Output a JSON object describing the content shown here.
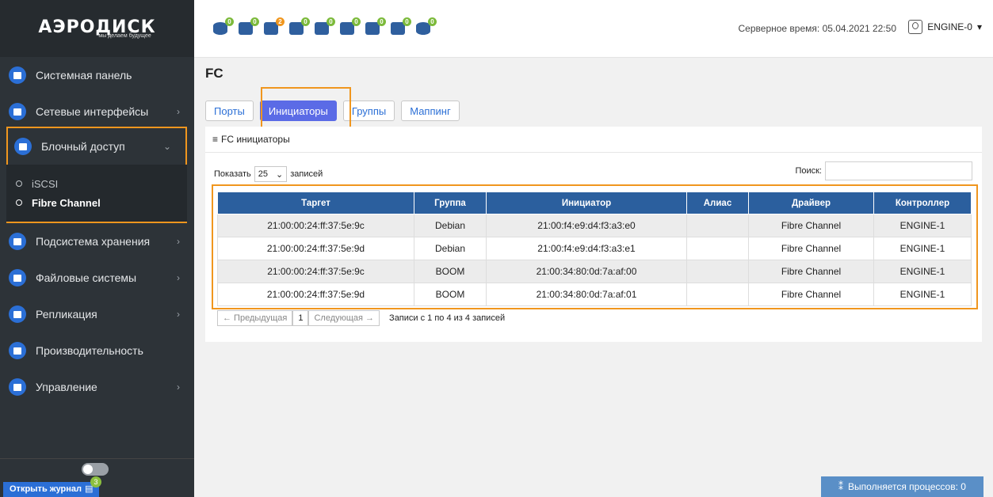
{
  "app": {
    "logo_text": "АЭРОДИСК",
    "logo_tagline": "мы делаем будущее"
  },
  "sidebar": {
    "items": [
      {
        "label": "Системная панель",
        "icon": "monitor-icon",
        "chevron": ""
      },
      {
        "label": "Сетевые интерфейсы",
        "icon": "network-icon",
        "chevron": "›"
      },
      {
        "label": "Блочный доступ",
        "icon": "block-icon",
        "chevron": "⌄"
      },
      {
        "label": "Подсистема хранения",
        "icon": "database-icon",
        "chevron": "›"
      },
      {
        "label": "Файловые системы",
        "icon": "files-icon",
        "chevron": "›"
      },
      {
        "label": "Репликация",
        "icon": "replication-icon",
        "chevron": "›"
      },
      {
        "label": "Производительность",
        "icon": "performance-icon",
        "chevron": ""
      },
      {
        "label": "Управление",
        "icon": "settings-icon",
        "chevron": "›"
      }
    ],
    "subitems": [
      {
        "label": "iSCSI",
        "active": false
      },
      {
        "label": "Fibre Channel",
        "active": true
      }
    ],
    "journal_label": "Открыть журнал",
    "journal_count": "3"
  },
  "topbar": {
    "status_icons": [
      {
        "name": "disk-icon",
        "badge": "0"
      },
      {
        "name": "cpu-icon",
        "badge": "0"
      },
      {
        "name": "network-switch-icon",
        "badge": "2",
        "warn": true
      },
      {
        "name": "server-icon",
        "badge": "0"
      },
      {
        "name": "storage-icon",
        "badge": "0"
      },
      {
        "name": "wireless-icon",
        "badge": "0"
      },
      {
        "name": "drive-icon",
        "badge": "0"
      },
      {
        "name": "memory-icon",
        "badge": "0"
      },
      {
        "name": "cluster-icon",
        "badge": "0"
      }
    ],
    "server_time": "Серверное время: 05.04.2021 22:50",
    "engine": "ENGINE-0"
  },
  "page": {
    "title": "FC",
    "tabs": [
      "Порты",
      "Инициаторы",
      "Группы",
      "Маппинг"
    ],
    "active_tab": 1,
    "card_title": "FC инициаторы",
    "show_label": "Показать",
    "show_value": "25",
    "records_label": "записей",
    "search_label": "Поиск:",
    "search_value": "",
    "table": {
      "headers": [
        "Таргет",
        "Группа",
        "Инициатор",
        "Алиас",
        "Драйвер",
        "Контроллер"
      ],
      "rows": [
        [
          "21:00:00:24:ff:37:5e:9c",
          "Debian",
          "21:00:f4:e9:d4:f3:a3:e0",
          "",
          "Fibre Channel",
          "ENGINE-1"
        ],
        [
          "21:00:00:24:ff:37:5e:9d",
          "Debian",
          "21:00:f4:e9:d4:f3:a3:e1",
          "",
          "Fibre Channel",
          "ENGINE-1"
        ],
        [
          "21:00:00:24:ff:37:5e:9c",
          "BOOM",
          "21:00:34:80:0d:7a:af:00",
          "",
          "Fibre Channel",
          "ENGINE-1"
        ],
        [
          "21:00:00:24:ff:37:5e:9d",
          "BOOM",
          "21:00:34:80:0d:7a:af:01",
          "",
          "Fibre Channel",
          "ENGINE-1"
        ]
      ]
    },
    "pager": {
      "prev": "← Предыдущая",
      "current": "1",
      "next": "Следующая →",
      "info": "Записи с 1 по 4 из 4 записей"
    },
    "process_status": "Выполняется процессов: 0"
  }
}
